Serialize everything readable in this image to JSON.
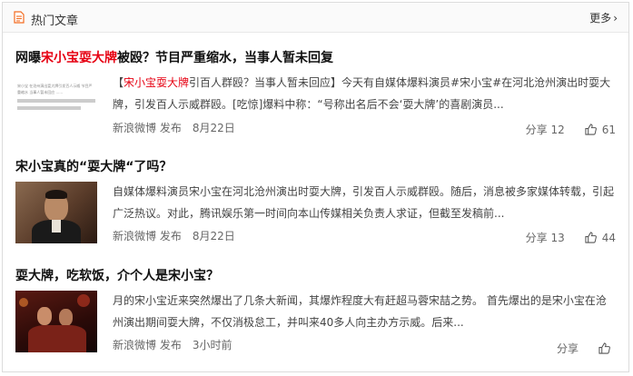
{
  "header": {
    "title": "热门文章",
    "more_label": "更多"
  },
  "articles": [
    {
      "title_prefix": "网曝",
      "title_highlight": "宋小宝耍大牌",
      "title_suffix": "被殴？节目严重缩水，当事人暂未回复",
      "summary_prefix": "【",
      "summary_highlight": "宋小宝耍大牌",
      "summary_rest": "引百人群殴？当事人暂未回应】今天有自媒体爆料演员#宋小宝#在河北沧州演出时耍大牌，引发百人示威群殴。[吃惊]爆料中称：“号称出名后不会‘耍大牌’的喜剧演员...",
      "thumb_text": "宋小宝 在沧州演出耍大牌引发百人示威 节目严重缩水 当事人暂未回应 ......",
      "source": "新浪微博",
      "verb": "发布",
      "date": "8月22日",
      "share_label": "分享",
      "share_count": "12",
      "like_count": "61"
    },
    {
      "title": "宋小宝真的“耍大牌“了吗？",
      "summary": "自媒体爆料演员宋小宝在河北沧州演出时耍大牌，引发百人示威群殴。随后，消息被多家媒体转载，引起广泛热议。对此，腾讯娱乐第一时间向本山传媒相关负责人求证，但截至发稿前...",
      "source": "新浪微博",
      "verb": "发布",
      "date": "8月22日",
      "share_label": "分享",
      "share_count": "13",
      "like_count": "44"
    },
    {
      "title": "耍大牌，吃软饭，介个人是宋小宝？",
      "summary": "月的宋小宝近来突然爆出了几条大新闻，其爆炸程度大有赶超马蓉宋喆之势。   首先爆出的是宋小宝在沧州演出期间耍大牌，不仅消极怠工，并叫来40多人向主办方示威。后来...",
      "source": "新浪微博",
      "verb": "发布",
      "date": "3小时前",
      "share_label": "分享",
      "share_count": "",
      "like_count": ""
    }
  ],
  "colors": {
    "highlight": "#e60012",
    "icon_orange": "#f36c21"
  },
  "icons": {
    "header": "document-icon",
    "like": "thumbs-up-icon",
    "more": "chevron-right-icon"
  }
}
